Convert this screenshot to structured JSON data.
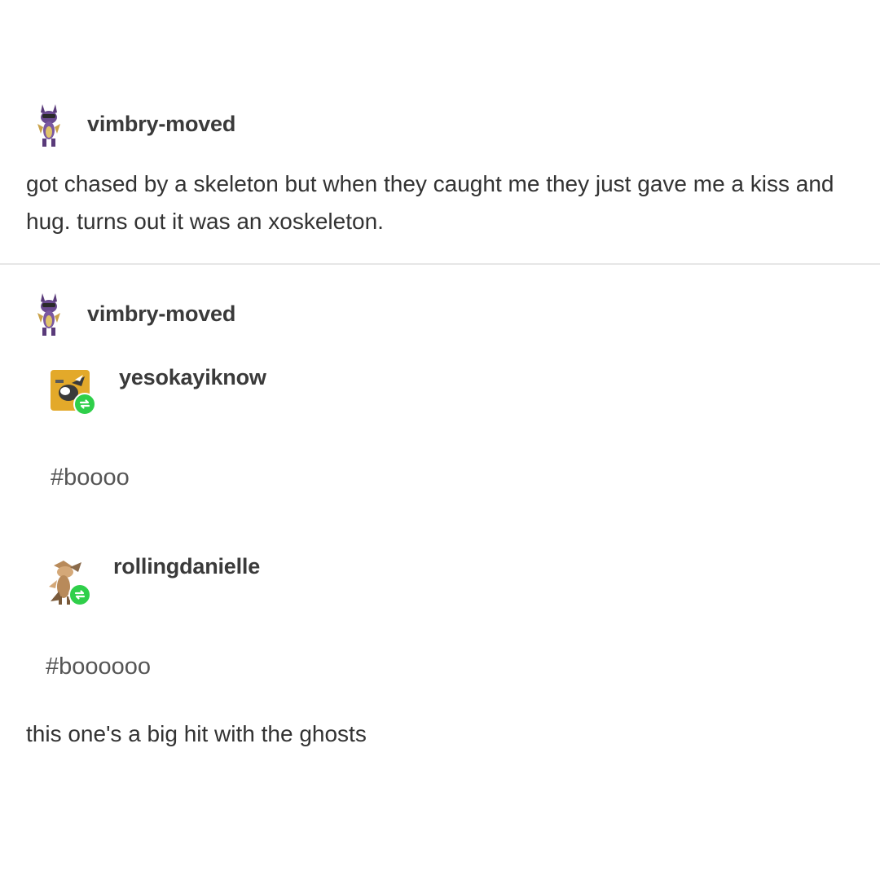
{
  "posts": [
    {
      "username": "vimbry-moved",
      "body": "got chased by a skeleton but when they caught me they just gave me a kiss and hug. turns out it was an xoskeleton."
    },
    {
      "username": "vimbry-moved",
      "reblogs": [
        {
          "username": "yesokayiknow",
          "tag": "#boooo"
        },
        {
          "username": "rollingdanielle",
          "tag": "#boooooo"
        }
      ],
      "body": "this one's a big hit with the ghosts"
    }
  ],
  "icons": {
    "avatar_op": "purple-dragon-avatar-icon",
    "avatar_reblog1": "yellow-bird-avatar-icon",
    "avatar_reblog2": "brown-dragon-avatar-icon",
    "reblog_badge": "reblog-icon"
  },
  "colors": {
    "reblog_badge": "#2fcf4a",
    "avatar1_bg": "#e3a92a",
    "divider": "#e6e6e6"
  }
}
